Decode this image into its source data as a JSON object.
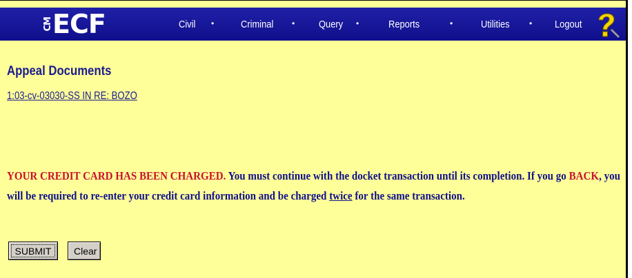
{
  "app": {
    "logo_prefix": "CM",
    "logo_text": "ECF"
  },
  "nav": {
    "items": [
      {
        "label": "Civil"
      },
      {
        "label": "Criminal"
      },
      {
        "label": "Query"
      },
      {
        "label": "Reports"
      },
      {
        "label": "Utilities"
      },
      {
        "label": "Logout"
      }
    ],
    "separator": "•",
    "help_icon": "question-mark-icon"
  },
  "main": {
    "title": "Appeal Documents",
    "case_link": "1:03-cv-03030-SS IN RE: BOZO",
    "warning": {
      "charged": "YOUR CREDIT CARD HAS BEEN CHARGED.",
      "part1": " You must continue with the docket transaction until its completion. If you go ",
      "back": "BACK",
      "part2": ", you will be required to re-enter your credit card information and be charged ",
      "twice": "twice",
      "part3": " for the same transaction."
    }
  },
  "form": {
    "submit_label": "SUBMIT",
    "clear_label": "Clear"
  },
  "colors": {
    "navbar": "#1a1a9e",
    "background": "#ffff99",
    "heading": "#1b1b8f",
    "alert": "#c8102e"
  }
}
